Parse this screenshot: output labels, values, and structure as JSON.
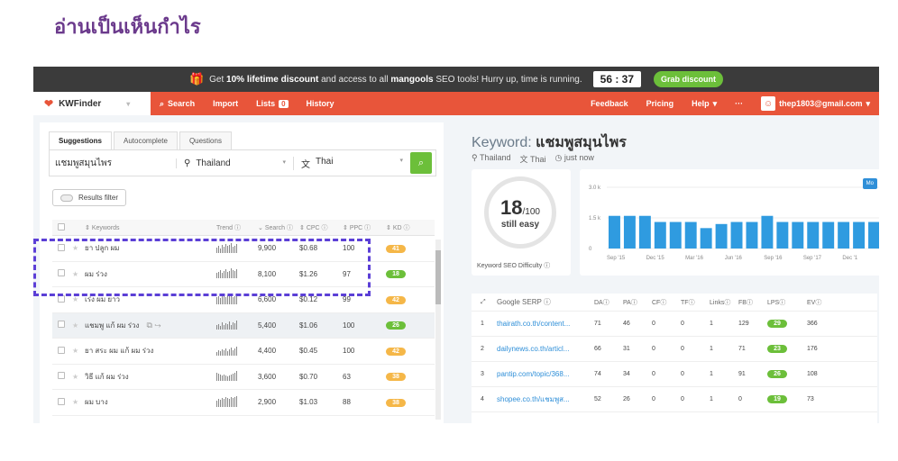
{
  "page_heading": "อ่านเป็นเห็นกำไร",
  "promo": {
    "text1": "Get ",
    "bold1": "10% lifetime discount",
    "text2": " and access to all ",
    "bold2": "mangools",
    "text3": " SEO tools! Hurry up, time is running.",
    "timer": "56 : 37",
    "button": "Grab discount"
  },
  "nav": {
    "brand": "KWFinder",
    "search": "Search",
    "import": "Import",
    "lists": "Lists",
    "lists_count": "0",
    "history": "History",
    "feedback": "Feedback",
    "pricing": "Pricing",
    "help": "Help",
    "more": "···",
    "email": "thep1803@gmail.com"
  },
  "tabs": [
    "Suggestions",
    "Autocomplete",
    "Questions"
  ],
  "search": {
    "keyword": "แชมพูสมุนไพร",
    "location": "Thailand",
    "language": "Thai"
  },
  "filter_label": "Results filter",
  "table": {
    "headers": [
      "Keywords",
      "Trend",
      "Search",
      "CPC",
      "PPC",
      "KD"
    ],
    "rows": [
      {
        "kw": "ยา ปลูก ผม",
        "vol": "9,900",
        "cpc": "$0.68",
        "ppc": "100",
        "kd": "41",
        "color": "#f5b748",
        "trend": [
          6,
          8,
          5,
          9,
          7,
          10,
          8,
          9,
          11,
          7,
          8,
          10
        ]
      },
      {
        "kw": "ผม ร่วง",
        "vol": "8,100",
        "cpc": "$1.26",
        "ppc": "97",
        "kd": "18",
        "color": "#6cbf3a",
        "trend": [
          6,
          7,
          9,
          6,
          8,
          10,
          7,
          8,
          11,
          9,
          8,
          10
        ]
      },
      {
        "kw": "เร่ง ผม ยาว",
        "vol": "6,600",
        "cpc": "$0.12",
        "ppc": "99",
        "kd": "42",
        "color": "#f5b748",
        "trend": [
          8,
          9,
          7,
          10,
          9,
          8,
          10,
          9,
          11,
          8,
          9,
          10
        ]
      },
      {
        "kw": "แชมพู แก้ ผม ร่วง",
        "vol": "5,400",
        "cpc": "$1.06",
        "ppc": "100",
        "kd": "26",
        "color": "#6cbf3a",
        "trend": [
          5,
          6,
          4,
          8,
          5,
          7,
          6,
          9,
          5,
          8,
          7,
          10
        ]
      },
      {
        "kw": "ยา สระ ผม แก้ ผม ร่วง",
        "vol": "4,400",
        "cpc": "$0.45",
        "ppc": "100",
        "kd": "42",
        "color": "#f5b748",
        "trend": [
          4,
          6,
          5,
          7,
          6,
          8,
          5,
          7,
          9,
          6,
          8,
          10
        ]
      },
      {
        "kw": "วิธี แก้ ผม ร่วง",
        "vol": "3,600",
        "cpc": "$0.70",
        "ppc": "63",
        "kd": "38",
        "color": "#f5b748",
        "trend": [
          9,
          8,
          7,
          6,
          7,
          6,
          5,
          6,
          7,
          8,
          9,
          11
        ]
      },
      {
        "kw": "ผม บาง",
        "vol": "2,900",
        "cpc": "$1.03",
        "ppc": "88",
        "kd": "38",
        "color": "#f5b748",
        "trend": [
          7,
          9,
          8,
          10,
          9,
          11,
          10,
          9,
          11,
          10,
          11,
          12
        ]
      }
    ]
  },
  "right": {
    "title_prefix": "Keyword: ",
    "title_kw": "แชมพูสมุนไพร",
    "location": "Thailand",
    "language": "Thai",
    "time": "just now",
    "kd_value": "18",
    "kd_max": "/100",
    "kd_label": "still easy",
    "kd_caption": "Keyword SEO Difficulty",
    "mo_button": "Mo"
  },
  "chart_data": {
    "type": "bar",
    "y_ticks": [
      "3.0 k",
      "1.5 k",
      "0"
    ],
    "x_ticks": [
      "Sep '15",
      "Dec '15",
      "Mar '16",
      "Jun '16",
      "Sep '16",
      "Sep '17",
      "Dec '1"
    ],
    "ylim": [
      0,
      3000
    ],
    "values": [
      1600,
      1600,
      1600,
      1300,
      1300,
      1300,
      1000,
      1200,
      1300,
      1300,
      1600,
      1300,
      1300,
      1300,
      1300,
      1300,
      1300,
      1300
    ]
  },
  "serp": {
    "headers": [
      "Google SERP",
      "DA",
      "PA",
      "CF",
      "TF",
      "Links",
      "FB",
      "LPS",
      "EV"
    ],
    "rows": [
      {
        "i": "1",
        "url": "thairath.co.th/content...",
        "da": "71",
        "pa": "46",
        "cf": "0",
        "tf": "0",
        "links": "1",
        "fb": "129",
        "lps": "29",
        "ev": "366"
      },
      {
        "i": "2",
        "url": "dailynews.co.th/articl...",
        "da": "66",
        "pa": "31",
        "cf": "0",
        "tf": "0",
        "links": "1",
        "fb": "71",
        "lps": "23",
        "ev": "176"
      },
      {
        "i": "3",
        "url": "pantip.com/topic/368...",
        "da": "74",
        "pa": "34",
        "cf": "0",
        "tf": "0",
        "links": "1",
        "fb": "91",
        "lps": "26",
        "ev": "108"
      },
      {
        "i": "4",
        "url": "shopee.co.th/แชมพูส...",
        "da": "52",
        "pa": "26",
        "cf": "0",
        "tf": "0",
        "links": "1",
        "fb": "0",
        "lps": "19",
        "ev": "73"
      }
    ]
  }
}
